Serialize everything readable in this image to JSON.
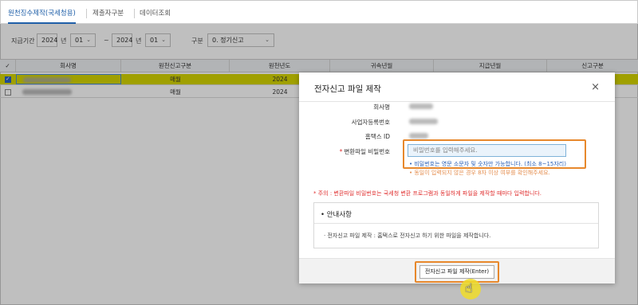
{
  "tabs": [
    {
      "label": "원천징수제작(국세청용)",
      "active": true
    },
    {
      "label": "제출자구분",
      "active": false
    },
    {
      "label": "데이터조회",
      "active": false
    }
  ],
  "filter": {
    "period_label": "지급기간",
    "from_year": "2024",
    "year_unit": "년",
    "from_month": "01",
    "tilde": "~",
    "to_year": "2024",
    "to_month": "01",
    "type_label": "구분",
    "type_value": "0. 정기신고"
  },
  "grid": {
    "headers": [
      "회사명",
      "원천신고구분",
      "원천년도",
      "귀속년월",
      "지급년월",
      "신고구분"
    ],
    "rows": [
      {
        "checked": true,
        "report_type": "매월",
        "year": "2024"
      },
      {
        "checked": false,
        "report_type": "매월",
        "year": "2024"
      }
    ]
  },
  "modal": {
    "title": "전자신고 파일 제작",
    "close": "×",
    "fields": {
      "company_label": "회사명",
      "bizno_label": "사업자등록번호",
      "hometax_label": "홈택스 ID",
      "password_label": "변환파일 비밀번호",
      "password_required": "*",
      "password_placeholder": "비밀번호를 입력해주세요.",
      "password_hint": "• 비밀번호는 영문 소문자 및 숫자만 가능합니다. (최소 8~15자리)",
      "password_hint2": "• 동일이 입력되지 않은 경우 8자 이상 여부를 확인해주세요."
    },
    "warning": "* 주의 : 변환파일 비밀번호는 국세청 변환 프로그램과 동일하게 파일을 제작할 때마다 입력합니다.",
    "guide": {
      "title": "• 안내사항",
      "text": "· 전자신고 파일 제작 : 홈택스로 전자신고 하기 위한 파일을 제작합니다."
    },
    "submit_label": "전자신고 파일 제작(Enter)"
  },
  "colors": {
    "selected_row": "#d6d600",
    "highlight_box": "#e7882c",
    "active_tab": "#1f5fa8"
  }
}
